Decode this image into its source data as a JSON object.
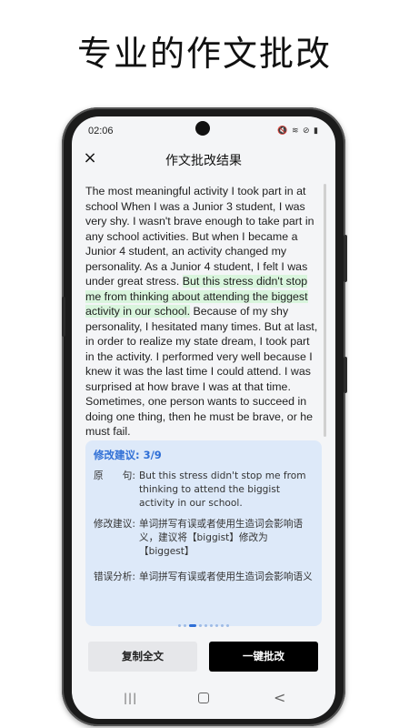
{
  "headline": "专业的作文批改",
  "status_bar": {
    "time": "02:06",
    "icons": "🔇 ≋ ⊘ ▮"
  },
  "app_bar": {
    "close_icon": "×",
    "title": "作文批改结果"
  },
  "essay": {
    "text_before": "The most meaningful activity I took part in at school When I was a Junior 3 student, I was very shy. I wasn't brave enough to take part in any school activities. But when I became a Junior 4 student, an activity changed my personality.  As a Junior 4 student, I felt I was under great stress. ",
    "highlight": "But this stress didn't stop me from thinking about attending the biggest activity in our school.",
    "text_after": " Because of my shy personality, I hesitated many times. But at last, in order to realize my state dream, I took part in the activity.  I performed very well because I knew it was the last time I could attend. I was surprised at how brave I was at that time. Sometimes, one person wants to succeed in doing one thing, then he must be brave, or he must fail."
  },
  "suggestion": {
    "title": "修改建议: 3/9",
    "original_label": "原　　句:",
    "original_text": "But this stress didn't stop me from thinking to attend the biggist activity in our school.",
    "advice_label": "修改建议:",
    "advice_text": "单词拼写有误或者使用生造词会影响语义，建议将【biggist】修改为【biggest】",
    "analysis_label": "错误分析:",
    "analysis_text": "单词拼写有误或者使用生造词会影响语义",
    "page_total": 9,
    "page_current": 3
  },
  "buttons": {
    "copy_label": "复制全文",
    "fix_label": "一键批改"
  },
  "nav": {
    "recent_icon": "|||",
    "back_icon": "<"
  }
}
